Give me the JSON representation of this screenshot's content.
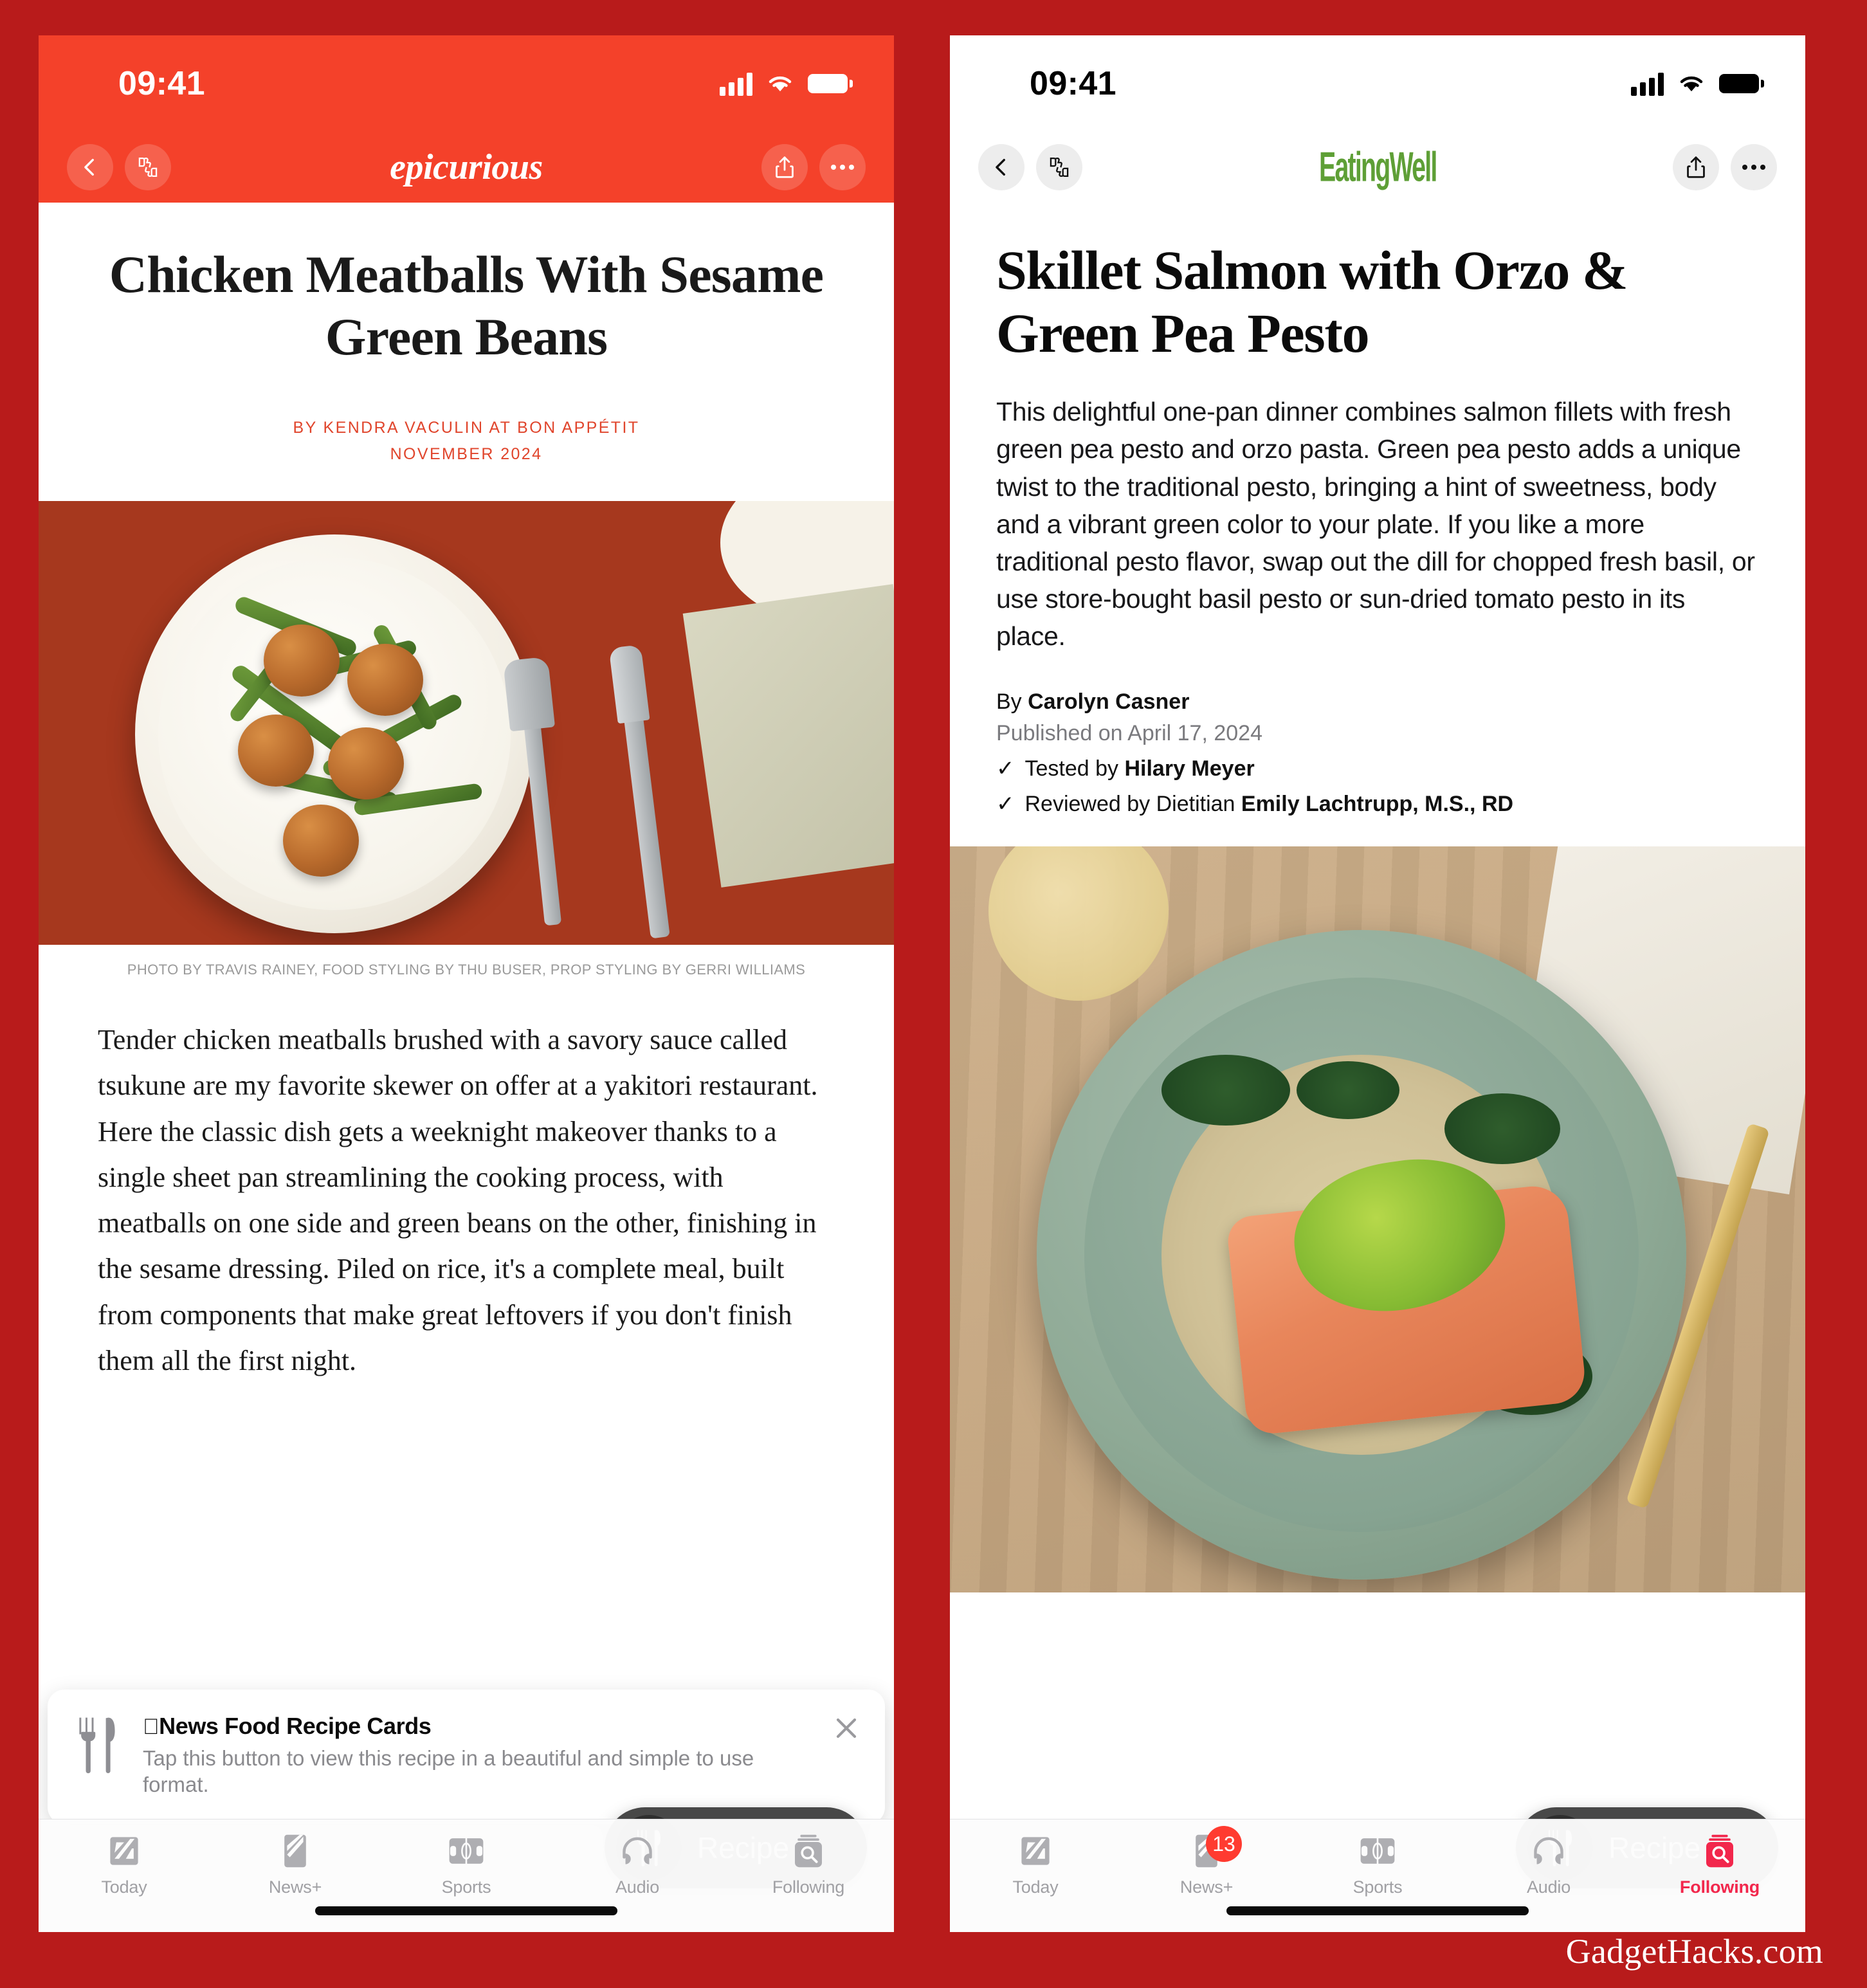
{
  "watermark": "GadgetHacks.com",
  "left_phone": {
    "status": {
      "time": "09:41",
      "signal_icon": "cellular-bars-icon",
      "wifi_icon": "wifi-icon",
      "battery_icon": "battery-icon"
    },
    "nav": {
      "back_icon": "back-chevron-icon",
      "rating_icon": "thumbs-up-down-icon",
      "brand": "epicurious",
      "share_icon": "share-icon",
      "more_icon": "more-ellipsis-icon"
    },
    "article": {
      "title": "Chicken Meatballs With Sesame Green Beans",
      "byline_author": "BY KENDRA VACULIN AT BON APPÉTIT",
      "byline_date": "NOVEMBER 2024",
      "photo_credit": "PHOTO BY TRAVIS RAINEY, FOOD STYLING BY THU BUSER, PROP STYLING BY GERRI WILLIAMS",
      "body": "Tender chicken meatballs brushed with a savory sauce called tsukune are my favorite skewer on offer at a yakitori restaurant. Here the classic dish gets a weeknight makeover thanks to a single sheet pan streamlining the cooking process, with meatballs on one side and green beans on the other, finishing in the sesame dressing. Piled on rice, it's a complete meal, built from components that make great leftovers if you don't finish them all the first night."
    },
    "popup": {
      "icon": "fork-knife-icon",
      "title": "News Food Recipe Cards",
      "apple_glyph": "",
      "subtitle": "Tap this button to view this recipe in a beautiful and simple to use format.",
      "close_icon": "close-x-icon"
    },
    "recipe_pill": {
      "icon": "fork-knife-icon",
      "label": "Recipe"
    },
    "tabs": [
      {
        "label": "Today",
        "icon": "apple-news-icon",
        "active": false,
        "badge": ""
      },
      {
        "label": "News+",
        "icon": "news-plus-icon",
        "active": false,
        "badge": ""
      },
      {
        "label": "Sports",
        "icon": "sports-field-icon",
        "active": false,
        "badge": ""
      },
      {
        "label": "Audio",
        "icon": "headphones-icon",
        "active": false,
        "badge": ""
      },
      {
        "label": "Following",
        "icon": "following-search-icon",
        "active": false,
        "badge": ""
      }
    ]
  },
  "right_phone": {
    "status": {
      "time": "09:41",
      "signal_icon": "cellular-bars-icon",
      "wifi_icon": "wifi-icon",
      "battery_icon": "battery-icon"
    },
    "nav": {
      "back_icon": "back-chevron-icon",
      "rating_icon": "thumbs-up-down-icon",
      "brand": "EatingWell",
      "share_icon": "share-icon",
      "more_icon": "more-ellipsis-icon"
    },
    "article": {
      "title": "Skillet Salmon with Orzo & Green Pea Pesto",
      "description": "This delightful one-pan dinner combines salmon fillets with fresh green pea pesto and orzo pasta. Green pea pesto adds a unique twist to the traditional pesto, bringing a hint of sweetness, body and a vibrant green color to your plate. If you like a more traditional pesto flavor, swap out the dill for chopped fresh basil, or use store-bought basil pesto or sun-dried tomato pesto in its place.",
      "by_prefix": "By ",
      "author": "Carolyn Casner",
      "published": "Published on April 17, 2024",
      "tested_prefix": "Tested by ",
      "tested_by": "Hilary Meyer",
      "reviewed_prefix": "Reviewed by Dietitian ",
      "reviewed_by": "Emily Lachtrupp, M.S., RD",
      "check_icon": "check-mark-icon"
    },
    "recipe_pill": {
      "icon": "fork-knife-icon",
      "label": "Recipe"
    },
    "tabs": [
      {
        "label": "Today",
        "icon": "apple-news-icon",
        "active": false,
        "badge": ""
      },
      {
        "label": "News+",
        "icon": "news-plus-icon",
        "active": false,
        "badge": "13"
      },
      {
        "label": "Sports",
        "icon": "sports-field-icon",
        "active": false,
        "badge": ""
      },
      {
        "label": "Audio",
        "icon": "headphones-icon",
        "active": false,
        "badge": ""
      },
      {
        "label": "Following",
        "icon": "following-search-icon",
        "active": true,
        "badge": ""
      }
    ]
  },
  "colors": {
    "page_background": "#B81B1B",
    "epicurious_header": "#F4412A",
    "epicurious_byline": "#E0452C",
    "eatingwell_green": "#5E9F36",
    "active_tab": "#F2274C",
    "badge_red": "#FF3B30"
  }
}
